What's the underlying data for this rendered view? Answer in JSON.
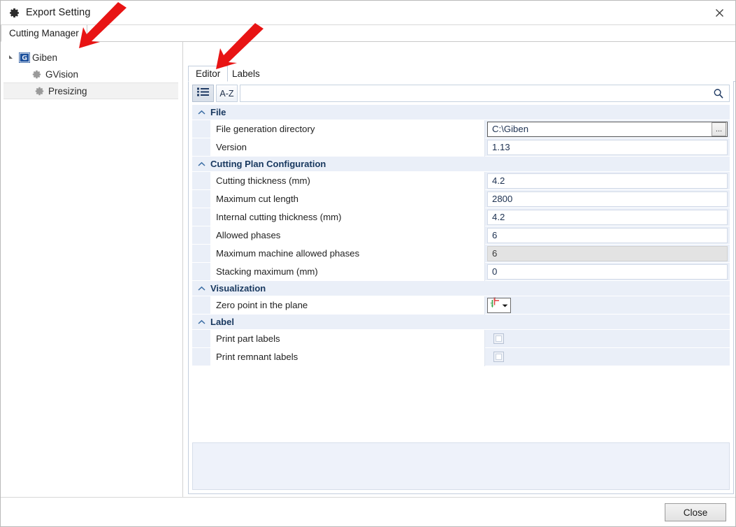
{
  "window": {
    "title": "Export Setting",
    "gear_icon": "gear-icon",
    "close_icon": "close-icon"
  },
  "outer_tabs": [
    {
      "label": "Cutting Manager",
      "active": true
    }
  ],
  "tree": {
    "root": {
      "label": "Giben",
      "icon": "giben-logo-icon",
      "expanded": true
    },
    "children": [
      {
        "label": "GVision",
        "icon": "gear-icon",
        "selected": false
      },
      {
        "label": "Presizing",
        "icon": "gear-icon",
        "selected": true
      }
    ]
  },
  "inner_tabs": [
    {
      "label": "Editor",
      "active": true
    },
    {
      "label": "Labels",
      "active": false
    }
  ],
  "toolbar": {
    "categorized_button": {
      "icon": "categorized-list-icon",
      "pressed": true
    },
    "sort_button": {
      "label": "A-Z",
      "icon": "sort-alpha-icon",
      "pressed": false
    },
    "search": {
      "value": "",
      "placeholder": "",
      "icon": "search-icon"
    }
  },
  "property_grid": {
    "categories": [
      {
        "name": "File",
        "collapse_icon": "chevron-up-icon",
        "rows": [
          {
            "label": "File generation directory",
            "value": "C:\\Giben",
            "type": "text-browse",
            "focused": true,
            "browse_label": "...",
            "browse_icon": "ellipsis-icon"
          },
          {
            "label": "Version",
            "value": "1.13",
            "type": "text",
            "focused": false
          }
        ]
      },
      {
        "name": "Cutting Plan Configuration",
        "collapse_icon": "chevron-up-icon",
        "rows": [
          {
            "label": "Cutting thickness (mm)",
            "value": "4.2",
            "type": "text"
          },
          {
            "label": "Maximum cut length",
            "value": "2800",
            "type": "text"
          },
          {
            "label": "Internal cutting thickness (mm)",
            "value": "4.2",
            "type": "text"
          },
          {
            "label": "Allowed phases",
            "value": "6",
            "type": "text"
          },
          {
            "label": "Maximum machine allowed phases",
            "value": "6",
            "type": "text",
            "disabled": true
          },
          {
            "label": "Stacking maximum (mm)",
            "value": "0",
            "type": "text"
          }
        ]
      },
      {
        "name": "Visualization",
        "collapse_icon": "chevron-up-icon",
        "rows": [
          {
            "label": "Zero point in the plane",
            "value": "",
            "type": "axis-dropdown",
            "icon": "axis-origin-icon",
            "dropdown_icon": "chevron-down-icon"
          }
        ]
      },
      {
        "name": "Label",
        "collapse_icon": "chevron-up-icon",
        "rows": [
          {
            "label": "Print part labels",
            "value": "",
            "type": "checkbox",
            "checked": false
          },
          {
            "label": "Print remnant labels",
            "value": "",
            "type": "checkbox",
            "checked": false
          }
        ]
      }
    ],
    "description_panel": ""
  },
  "footer": {
    "close_label": "Close"
  },
  "annotations": [
    {
      "name": "arrow-to-cutting-manager-tab",
      "color": "#e81414"
    },
    {
      "name": "arrow-to-editor-tab",
      "color": "#e81414"
    }
  ],
  "colors": {
    "category_header_bg": "#eaeff8",
    "category_header_text": "#17375e",
    "value_text": "#1c3050",
    "annotation_red": "#e81414"
  }
}
